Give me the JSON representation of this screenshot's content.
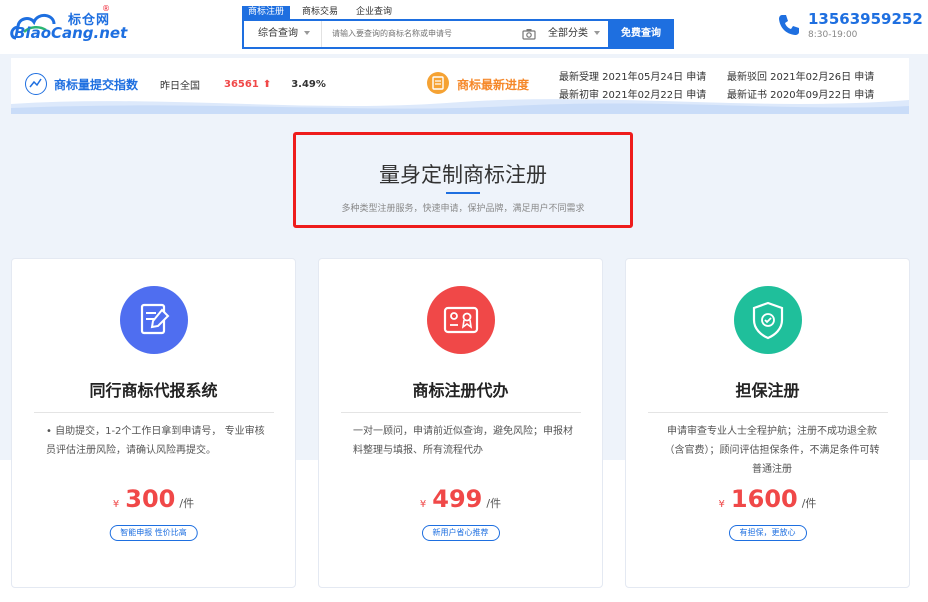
{
  "header": {
    "logo_cn": "标仓网",
    "logo_en": "BiaoCang.net",
    "logo_reg": "®",
    "search_tabs": [
      {
        "label": "商标注册",
        "active": true
      },
      {
        "label": "商标交易",
        "active": false
      },
      {
        "label": "企业查询",
        "active": false
      }
    ],
    "search_type": "综合查询",
    "search_placeholder": "请输入要查询的商标名称或申请号",
    "search_category": "全部分类",
    "search_button": "免费查询",
    "phone_number": "13563959252",
    "phone_hours": "8:30-19:00"
  },
  "stats": {
    "title": "商标量提交指数",
    "label": "昨日全国",
    "count": "36561",
    "trend_arrow": "⬆",
    "percent": "3.49%",
    "progress_title": "商标最新进度",
    "progress_items": [
      "最新受理 2021年05月24日 申请",
      "最新驳回 2021年02月26日 申请",
      "最新初审 2021年02月22日 申请",
      "最新证书 2020年09月22日 申请"
    ]
  },
  "headline": {
    "title": "量身定制商标注册",
    "subtitle": "多种类型注册服务，快速申请，保护品牌，满足用户不同需求"
  },
  "cards": [
    {
      "title": "同行商标代报系统",
      "desc": "• 自助提交，1-2个工作日拿到申请号， 专业审核员评估注册风险，请确认风险再提交。",
      "price_symbol": "¥",
      "price": "300",
      "unit": "/件",
      "tag": "智能申报 性价比高",
      "icon": "document-edit-icon",
      "color": "#4f6ef0"
    },
    {
      "title": "商标注册代办",
      "desc": "一对一顾问，申请前近似查询，避免风险；申报材料整理与填报、所有流程代办",
      "price_symbol": "¥",
      "price": "499",
      "unit": "/件",
      "tag": "新用户省心推荐",
      "icon": "id-card-icon",
      "color": "#f04848"
    },
    {
      "title": "担保注册",
      "desc": "申请审查专业人士全程护航；注册不成功退全款（含官费）；顾问评估担保条件，不满足条件可转普通注册",
      "price_symbol": "¥",
      "price": "1600",
      "unit": "/件",
      "tag": "有担保，更放心",
      "icon": "shield-check-icon",
      "color": "#1fbf9b"
    }
  ],
  "colors": {
    "brand_blue": "#1e6fe0",
    "accent_red": "#f04848",
    "accent_orange": "#f5882a",
    "highlight_border": "#ee1c1c"
  }
}
